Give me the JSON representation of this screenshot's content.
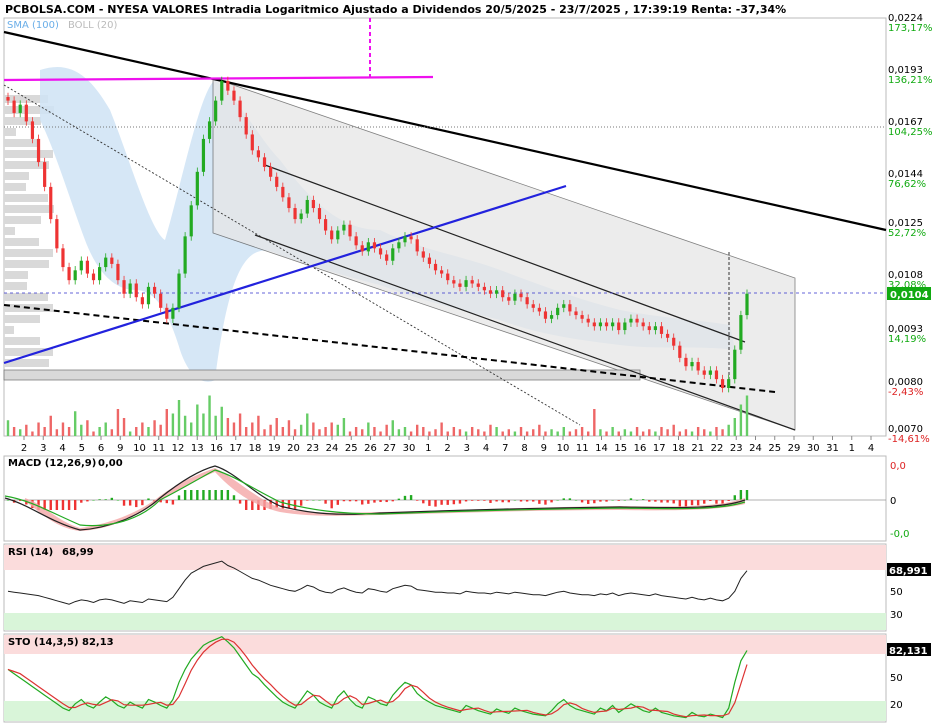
{
  "header": {
    "title": "PCBOLSA.COM - NYESA VALORES Intradia Logaritmico Ajustado a Dividendos 20/5/2025 - 23/7/2025 , 17:39:19 Renta: -37,34%",
    "legend_sma": "SMA (100)",
    "legend_boll": "BOLL (20)"
  },
  "price_axis": {
    "labels": [
      "0,0224",
      "0,0193",
      "0,0167",
      "0,0144",
      "0,0125",
      "0,0108",
      "0,0093",
      "0,0080",
      "0,0070"
    ],
    "percent_labels": [
      "173,17%",
      "136,21%",
      "104,25%",
      "76,62%",
      "52,72%",
      "32,08%",
      "14,19%",
      "-2,43%",
      "-14,61%"
    ],
    "current_price": "0,0104"
  },
  "x_axis": {
    "labels": [
      "2",
      "3",
      "4",
      "5",
      "6",
      "9",
      "10",
      "11",
      "12",
      "13",
      "16",
      "17",
      "18",
      "19",
      "20",
      "23",
      "24",
      "25",
      "26",
      "27",
      "30",
      "1",
      "2",
      "3",
      "4",
      "7",
      "8",
      "9",
      "10",
      "11",
      "14",
      "15",
      "16",
      "17",
      "18",
      "21",
      "22",
      "23",
      "24",
      "25",
      "29",
      "30",
      "31",
      "1",
      "4"
    ]
  },
  "macd": {
    "title": "MACD (12,26,9)",
    "value": "0,00",
    "axis": [
      "0,0",
      "0",
      "-0,0"
    ]
  },
  "rsi": {
    "title": "RSI (14)",
    "value": "68,99",
    "current": "68,991",
    "axis": [
      "50",
      "30"
    ]
  },
  "sto": {
    "title": "STO (14,3,5)",
    "value": "82,13",
    "current": "82,131",
    "axis": [
      "50",
      "20"
    ]
  },
  "colors": {
    "up": "#22aa22",
    "down": "#ee3333",
    "trend_black": "#000000",
    "trend_blue": "#2222dd",
    "magenta": "#ee11ee",
    "boll_fill": "#cfe3f5",
    "channel_fill": "#e6e6e6",
    "axis_green": "#11aa11"
  },
  "chart_data": {
    "type": "candlestick",
    "scale": "log",
    "ylim": [
      0.007,
      0.0224
    ],
    "close": [
      0.0178,
      0.0172,
      0.0176,
      0.0168,
      0.016,
      0.015,
      0.014,
      0.0128,
      0.0118,
      0.0112,
      0.0108,
      0.0111,
      0.0114,
      0.011,
      0.0108,
      0.0112,
      0.0115,
      0.0113,
      0.0108,
      0.0104,
      0.0107,
      0.0103,
      0.0101,
      0.0106,
      0.0104,
      0.01,
      0.0097,
      0.01,
      0.011,
      0.0122,
      0.0133,
      0.0146,
      0.016,
      0.0168,
      0.0178,
      0.0188,
      0.0183,
      0.0178,
      0.017,
      0.0162,
      0.0155,
      0.0152,
      0.0148,
      0.0144,
      0.014,
      0.0136,
      0.0132,
      0.0128,
      0.013,
      0.0135,
      0.0132,
      0.0128,
      0.0124,
      0.0121,
      0.0124,
      0.0126,
      0.0122,
      0.0119,
      0.0117,
      0.012,
      0.0118,
      0.0116,
      0.0114,
      0.0118,
      0.012,
      0.0122,
      0.0121,
      0.0117,
      0.0115,
      0.0113,
      0.0111,
      0.011,
      0.0108,
      0.0107,
      0.0106,
      0.0108,
      0.0107,
      0.0106,
      0.0105,
      0.0104,
      0.0105,
      0.0103,
      0.0102,
      0.0104,
      0.0103,
      0.0101,
      0.01,
      0.0099,
      0.0097,
      0.0098,
      0.01,
      0.0101,
      0.0099,
      0.0098,
      0.0097,
      0.0096,
      0.0095,
      0.0096,
      0.0095,
      0.0096,
      0.0094,
      0.0096,
      0.0097,
      0.0096,
      0.0095,
      0.0094,
      0.0095,
      0.0093,
      0.0092,
      0.009,
      0.0087,
      0.0085,
      0.0086,
      0.0084,
      0.0083,
      0.0084,
      0.0082,
      0.008,
      0.0082,
      0.0089,
      0.0098,
      0.0104
    ],
    "volume": [
      0.35,
      0.2,
      0.15,
      0.25,
      0.1,
      0.3,
      0.2,
      0.45,
      0.15,
      0.3,
      0.2,
      0.55,
      0.25,
      0.35,
      0.1,
      0.2,
      0.3,
      0.15,
      0.6,
      0.4,
      0.1,
      0.2,
      0.3,
      0.2,
      0.35,
      0.25,
      0.6,
      0.5,
      0.8,
      0.45,
      0.3,
      0.7,
      0.5,
      0.9,
      0.45,
      0.65,
      0.4,
      0.3,
      0.5,
      0.2,
      0.3,
      0.45,
      0.15,
      0.25,
      0.4,
      0.2,
      0.35,
      0.15,
      0.25,
      0.5,
      0.3,
      0.15,
      0.2,
      0.3,
      0.25,
      0.4,
      0.1,
      0.2,
      0.15,
      0.3,
      0.2,
      0.1,
      0.25,
      0.35,
      0.15,
      0.2,
      0.1,
      0.25,
      0.2,
      0.1,
      0.15,
      0.3,
      0.1,
      0.2,
      0.15,
      0.1,
      0.2,
      0.15,
      0.1,
      0.25,
      0.2,
      0.1,
      0.15,
      0.1,
      0.2,
      0.1,
      0.15,
      0.25,
      0.1,
      0.15,
      0.1,
      0.2,
      0.1,
      0.15,
      0.2,
      0.1,
      0.6,
      0.15,
      0.1,
      0.2,
      0.1,
      0.15,
      0.1,
      0.2,
      0.1,
      0.15,
      0.1,
      0.2,
      0.15,
      0.25,
      0.1,
      0.15,
      0.1,
      0.2,
      0.15,
      0.1,
      0.2,
      0.15,
      0.25,
      0.4,
      0.7,
      0.9
    ],
    "rsi": [
      45,
      44,
      43,
      42,
      41,
      40,
      38,
      36,
      34,
      32,
      30,
      33,
      35,
      34,
      32,
      35,
      36,
      35,
      33,
      31,
      34,
      33,
      32,
      36,
      35,
      34,
      33,
      38,
      48,
      58,
      66,
      70,
      74,
      76,
      78,
      80,
      75,
      72,
      68,
      64,
      60,
      58,
      55,
      52,
      50,
      48,
      46,
      45,
      48,
      52,
      50,
      46,
      44,
      43,
      47,
      49,
      46,
      44,
      43,
      48,
      47,
      45,
      44,
      48,
      50,
      52,
      51,
      47,
      46,
      45,
      44,
      44,
      43,
      43,
      42,
      45,
      44,
      43,
      43,
      42,
      44,
      43,
      42,
      44,
      43,
      42,
      41,
      41,
      40,
      42,
      44,
      45,
      43,
      42,
      41,
      41,
      40,
      42,
      41,
      43,
      40,
      42,
      43,
      42,
      41,
      40,
      42,
      40,
      39,
      38,
      37,
      36,
      38,
      36,
      35,
      37,
      35,
      34,
      37,
      45,
      60,
      69
    ],
    "sto": [
      60,
      55,
      50,
      45,
      40,
      35,
      30,
      25,
      20,
      15,
      12,
      20,
      25,
      18,
      15,
      22,
      28,
      24,
      18,
      15,
      22,
      18,
      15,
      25,
      22,
      18,
      15,
      25,
      45,
      60,
      72,
      80,
      88,
      92,
      95,
      98,
      92,
      85,
      75,
      65,
      55,
      50,
      42,
      35,
      28,
      22,
      18,
      15,
      25,
      35,
      30,
      22,
      18,
      15,
      28,
      35,
      25,
      18,
      15,
      28,
      25,
      20,
      18,
      30,
      38,
      45,
      42,
      32,
      26,
      22,
      18,
      16,
      14,
      12,
      10,
      18,
      15,
      12,
      10,
      8,
      14,
      11,
      9,
      15,
      12,
      10,
      8,
      7,
      6,
      12,
      20,
      25,
      18,
      14,
      12,
      10,
      8,
      15,
      12,
      18,
      10,
      15,
      20,
      16,
      12,
      10,
      15,
      10,
      8,
      6,
      5,
      4,
      10,
      6,
      5,
      8,
      6,
      4,
      15,
      45,
      70,
      82
    ],
    "x_labels": [
      "2",
      "3",
      "4",
      "5",
      "6",
      "9",
      "10",
      "11",
      "12",
      "13",
      "16",
      "17",
      "18",
      "19",
      "20",
      "23",
      "24",
      "25",
      "26",
      "27",
      "30",
      "1",
      "2",
      "3",
      "4",
      "7",
      "8",
      "9",
      "10",
      "11",
      "14",
      "15",
      "16",
      "17",
      "18",
      "21",
      "22",
      "23",
      "24",
      "25",
      "29",
      "30",
      "31",
      "1",
      "4"
    ]
  }
}
